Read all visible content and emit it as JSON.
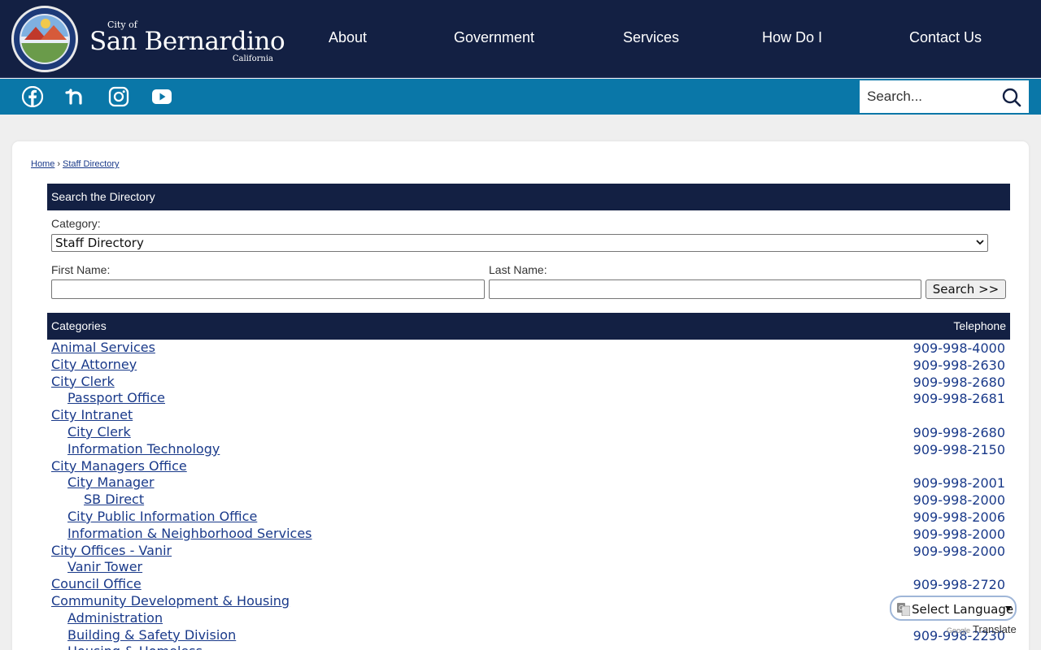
{
  "header": {
    "brand": {
      "city_of": "City of",
      "name": "San Bernardino",
      "state": "California"
    },
    "nav": [
      "About",
      "Government",
      "Services",
      "How Do I",
      "Contact Us"
    ]
  },
  "socialbar": {
    "icons": [
      "facebook-icon",
      "nextdoor-icon",
      "instagram-icon",
      "youtube-icon"
    ],
    "search": {
      "placeholder": "Search..."
    }
  },
  "breadcrumb": {
    "home": "Home",
    "separator": "›",
    "current": "Staff Directory"
  },
  "search_panel": {
    "title": "Search the Directory",
    "category_label": "Category:",
    "category_value": "Staff Directory",
    "first_name_label": "First Name:",
    "last_name_label": "Last Name:",
    "first_name_value": "",
    "last_name_value": "",
    "search_button": "Search >>"
  },
  "directory": {
    "col_categories": "Categories",
    "col_telephone": "Telephone",
    "rows": [
      {
        "name": "Animal Services",
        "level": 0,
        "phone": "909-998-4000"
      },
      {
        "name": "City Attorney",
        "level": 0,
        "phone": "909-998-2630"
      },
      {
        "name": "City Clerk",
        "level": 0,
        "phone": "909-998-2680"
      },
      {
        "name": "Passport Office",
        "level": 1,
        "phone": "909-998-2681"
      },
      {
        "name": "City Intranet",
        "level": 0,
        "phone": ""
      },
      {
        "name": "City Clerk",
        "level": 1,
        "phone": "909-998-2680"
      },
      {
        "name": "Information Technology",
        "level": 1,
        "phone": "909-998-2150"
      },
      {
        "name": "City Managers Office",
        "level": 0,
        "phone": ""
      },
      {
        "name": "City Manager",
        "level": 1,
        "phone": "909-998-2001"
      },
      {
        "name": "SB Direct",
        "level": 2,
        "phone": "909-998-2000"
      },
      {
        "name": "City Public Information Office",
        "level": 1,
        "phone": "909-998-2006"
      },
      {
        "name": "Information & Neighborhood Services",
        "level": 1,
        "phone": "909-998-2000"
      },
      {
        "name": "City Offices - Vanir",
        "level": 0,
        "phone": "909-998-2000"
      },
      {
        "name": "Vanir Tower",
        "level": 1,
        "phone": ""
      },
      {
        "name": "Council Office",
        "level": 0,
        "phone": "909-998-2720"
      },
      {
        "name": "Community Development & Housing",
        "level": 0,
        "phone": ""
      },
      {
        "name": "Administration",
        "level": 1,
        "phone": ""
      },
      {
        "name": "Building & Safety Division",
        "level": 1,
        "phone": "909-998-2230"
      },
      {
        "name": "Housing & Homeless",
        "level": 1,
        "phone": ""
      }
    ]
  },
  "translate": {
    "label": "Select Language",
    "powered_by": "Google",
    "translate": "Translate"
  },
  "colors": {
    "navy": "#132043",
    "teal": "#0a77a8",
    "link": "#1a3a8a"
  }
}
